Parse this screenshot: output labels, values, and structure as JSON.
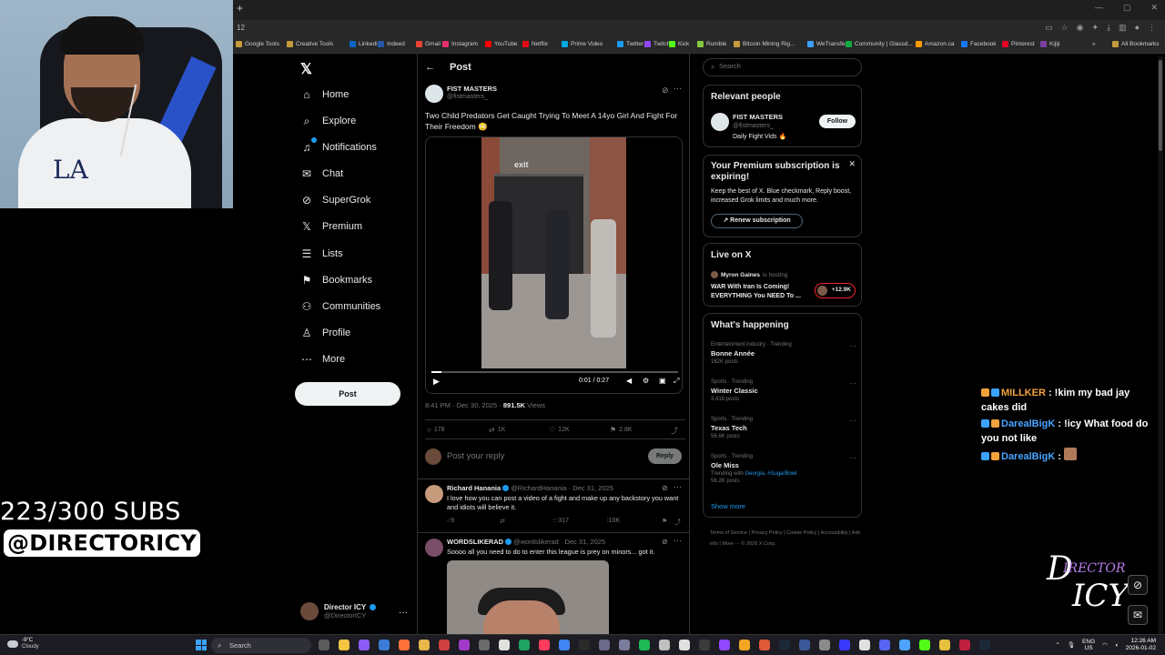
{
  "browser": {
    "new_tab": "+",
    "address_fragment": "12",
    "bookmarks": [
      {
        "label": "Google Tools",
        "color": "#c49a3b"
      },
      {
        "label": "Creative Tools",
        "color": "#c49a3b"
      },
      {
        "label": "Linkedin",
        "color": "#0a66c2"
      },
      {
        "label": "Indeed",
        "color": "#2557a7"
      },
      {
        "label": "Gmail",
        "color": "#ea4335"
      },
      {
        "label": "Instagram",
        "color": "#e1306c"
      },
      {
        "label": "YouTube",
        "color": "#ff0000"
      },
      {
        "label": "Netflix",
        "color": "#e50914"
      },
      {
        "label": "Prime Video",
        "color": "#00a8e1"
      },
      {
        "label": "Twitter",
        "color": "#1d9bf0"
      },
      {
        "label": "Twitch",
        "color": "#9146ff"
      },
      {
        "label": "Kick",
        "color": "#53fc18"
      },
      {
        "label": "Rumble",
        "color": "#85c742"
      },
      {
        "label": "Bitcoin Mining Rig...",
        "color": "#c49a3b"
      },
      {
        "label": "WeTransfer",
        "color": "#409fff"
      },
      {
        "label": "Community | Glassd...",
        "color": "#0caa41"
      },
      {
        "label": "Amazon.ca",
        "color": "#ff9900"
      },
      {
        "label": "Facebook",
        "color": "#1877f2"
      },
      {
        "label": "Pinterest",
        "color": "#e60023"
      },
      {
        "label": "Kijiji",
        "color": "#7b3fa0"
      }
    ],
    "all_bookmarks": "All Bookmarks"
  },
  "overlay": {
    "subs_goal": "223/300 SUBS",
    "handle": "@DIRECTORICY",
    "chat": [
      {
        "user": "MILLKER",
        "style": "orange",
        "message": "!kim my bad jay cakes did"
      },
      {
        "user": "DarealBigK",
        "style": "blue",
        "message": "!icy What food do you not like"
      },
      {
        "user": "DarealBigK",
        "style": "blue",
        "message": ""
      }
    ],
    "logo_line1": "D",
    "logo_line2": "IRECTOR",
    "logo_line3": "ICY"
  },
  "nav": {
    "items": [
      {
        "label": "Home",
        "icon": "⌂"
      },
      {
        "label": "Explore",
        "icon": "⌕"
      },
      {
        "label": "Notifications",
        "icon": "♫"
      },
      {
        "label": "Chat",
        "icon": "✉"
      },
      {
        "label": "SuperGrok",
        "icon": "⊘"
      },
      {
        "label": "Premium",
        "icon": "𝕏"
      },
      {
        "label": "Lists",
        "icon": "☰"
      },
      {
        "label": "Bookmarks",
        "icon": "⚑"
      },
      {
        "label": "Communities",
        "icon": "⚇"
      },
      {
        "label": "Profile",
        "icon": "♙"
      },
      {
        "label": "More",
        "icon": "⋯"
      }
    ],
    "post_button": "Post",
    "account_name": "Director ICY",
    "account_handle": "@DirectorICY"
  },
  "post": {
    "header_title": "Post",
    "author_name": "FIST MASTERS",
    "author_handle": "@fistmasters_",
    "text": "Two Child Predators Get Caught Trying To Meet A 14yo Girl And Fight For Their Freedom 😳",
    "video_overlay_text": "exit",
    "video_time": "0:01 / 0:27",
    "video_progress": 0.04,
    "time": "8:41 PM · Dec 30, 2025 · ",
    "views_count": "891.5K",
    "views_label": " Views",
    "replies": "178",
    "reposts": "1K",
    "likes": "12K",
    "bookmarks": "2.8K",
    "reply_placeholder": "Post your reply",
    "reply_button": "Reply"
  },
  "comments": [
    {
      "name": "Richard Hanania",
      "handle": "@RichardHanania · Dec 31, 2025",
      "text": "I love how you can post a video of a fight and make up any backstory you want and idiots will believe it.",
      "replies": "9",
      "reposts": "",
      "likes": "317",
      "views": "10K"
    },
    {
      "name": "WORDSLIKERAD",
      "handle": "@wordslikerad · Dec 31, 2025",
      "text": "Soooo all you need to do to enter this league is prey on minors... got it."
    }
  ],
  "sidebar": {
    "search_placeholder": "Search",
    "relevant_title": "Relevant people",
    "rp_name": "FIST MASTERS",
    "rp_handle": "@fistmasters_",
    "rp_bio": "Daily Fight Vids 🔥",
    "follow": "Follow",
    "premium_title": "Your Premium subscription is expiring!",
    "premium_body": "Keep the best of X. Blue checkmark, Reply boost, increased Grok limits and much more.",
    "renew": "Renew subscription",
    "live_title": "Live on X",
    "live_host_name": "Myron Gaines",
    "live_host_suffix": "is hosting",
    "live_stream_title": "WAR With Iran Is Coming! EVERYTHING You NEED To ...",
    "live_count": "+12.9K",
    "happening_title": "What's happening",
    "trends": [
      {
        "category": "Entertainment industry · Trending",
        "name": "Bonne Année",
        "sub": "162K posts"
      },
      {
        "category": "Sports · Trending",
        "name": "Winter Classic",
        "sub": "3,418 posts"
      },
      {
        "category": "Sports · Trending",
        "name": "Texas Tech",
        "sub": "56.6K posts"
      },
      {
        "category": "Sports · Trending",
        "name": "Ole Miss",
        "sub_prefix": "Trending with ",
        "sub_hl": "Georgia, #SugarBowl",
        "sub": "56.2K posts"
      }
    ],
    "show_more": "Show more",
    "footer": "Terms of Service  |  Privacy Policy  |  Cookie Policy  |  Accessibility  |  Ads info  |  More ···  © 2026 X Corp."
  },
  "taskbar": {
    "weather_temp": "-9°C",
    "weather_desc": "Cloudy",
    "search": "Search",
    "lang1": "ENG",
    "lang2": "US",
    "time": "12:26 AM",
    "date": "2026-01-02"
  }
}
